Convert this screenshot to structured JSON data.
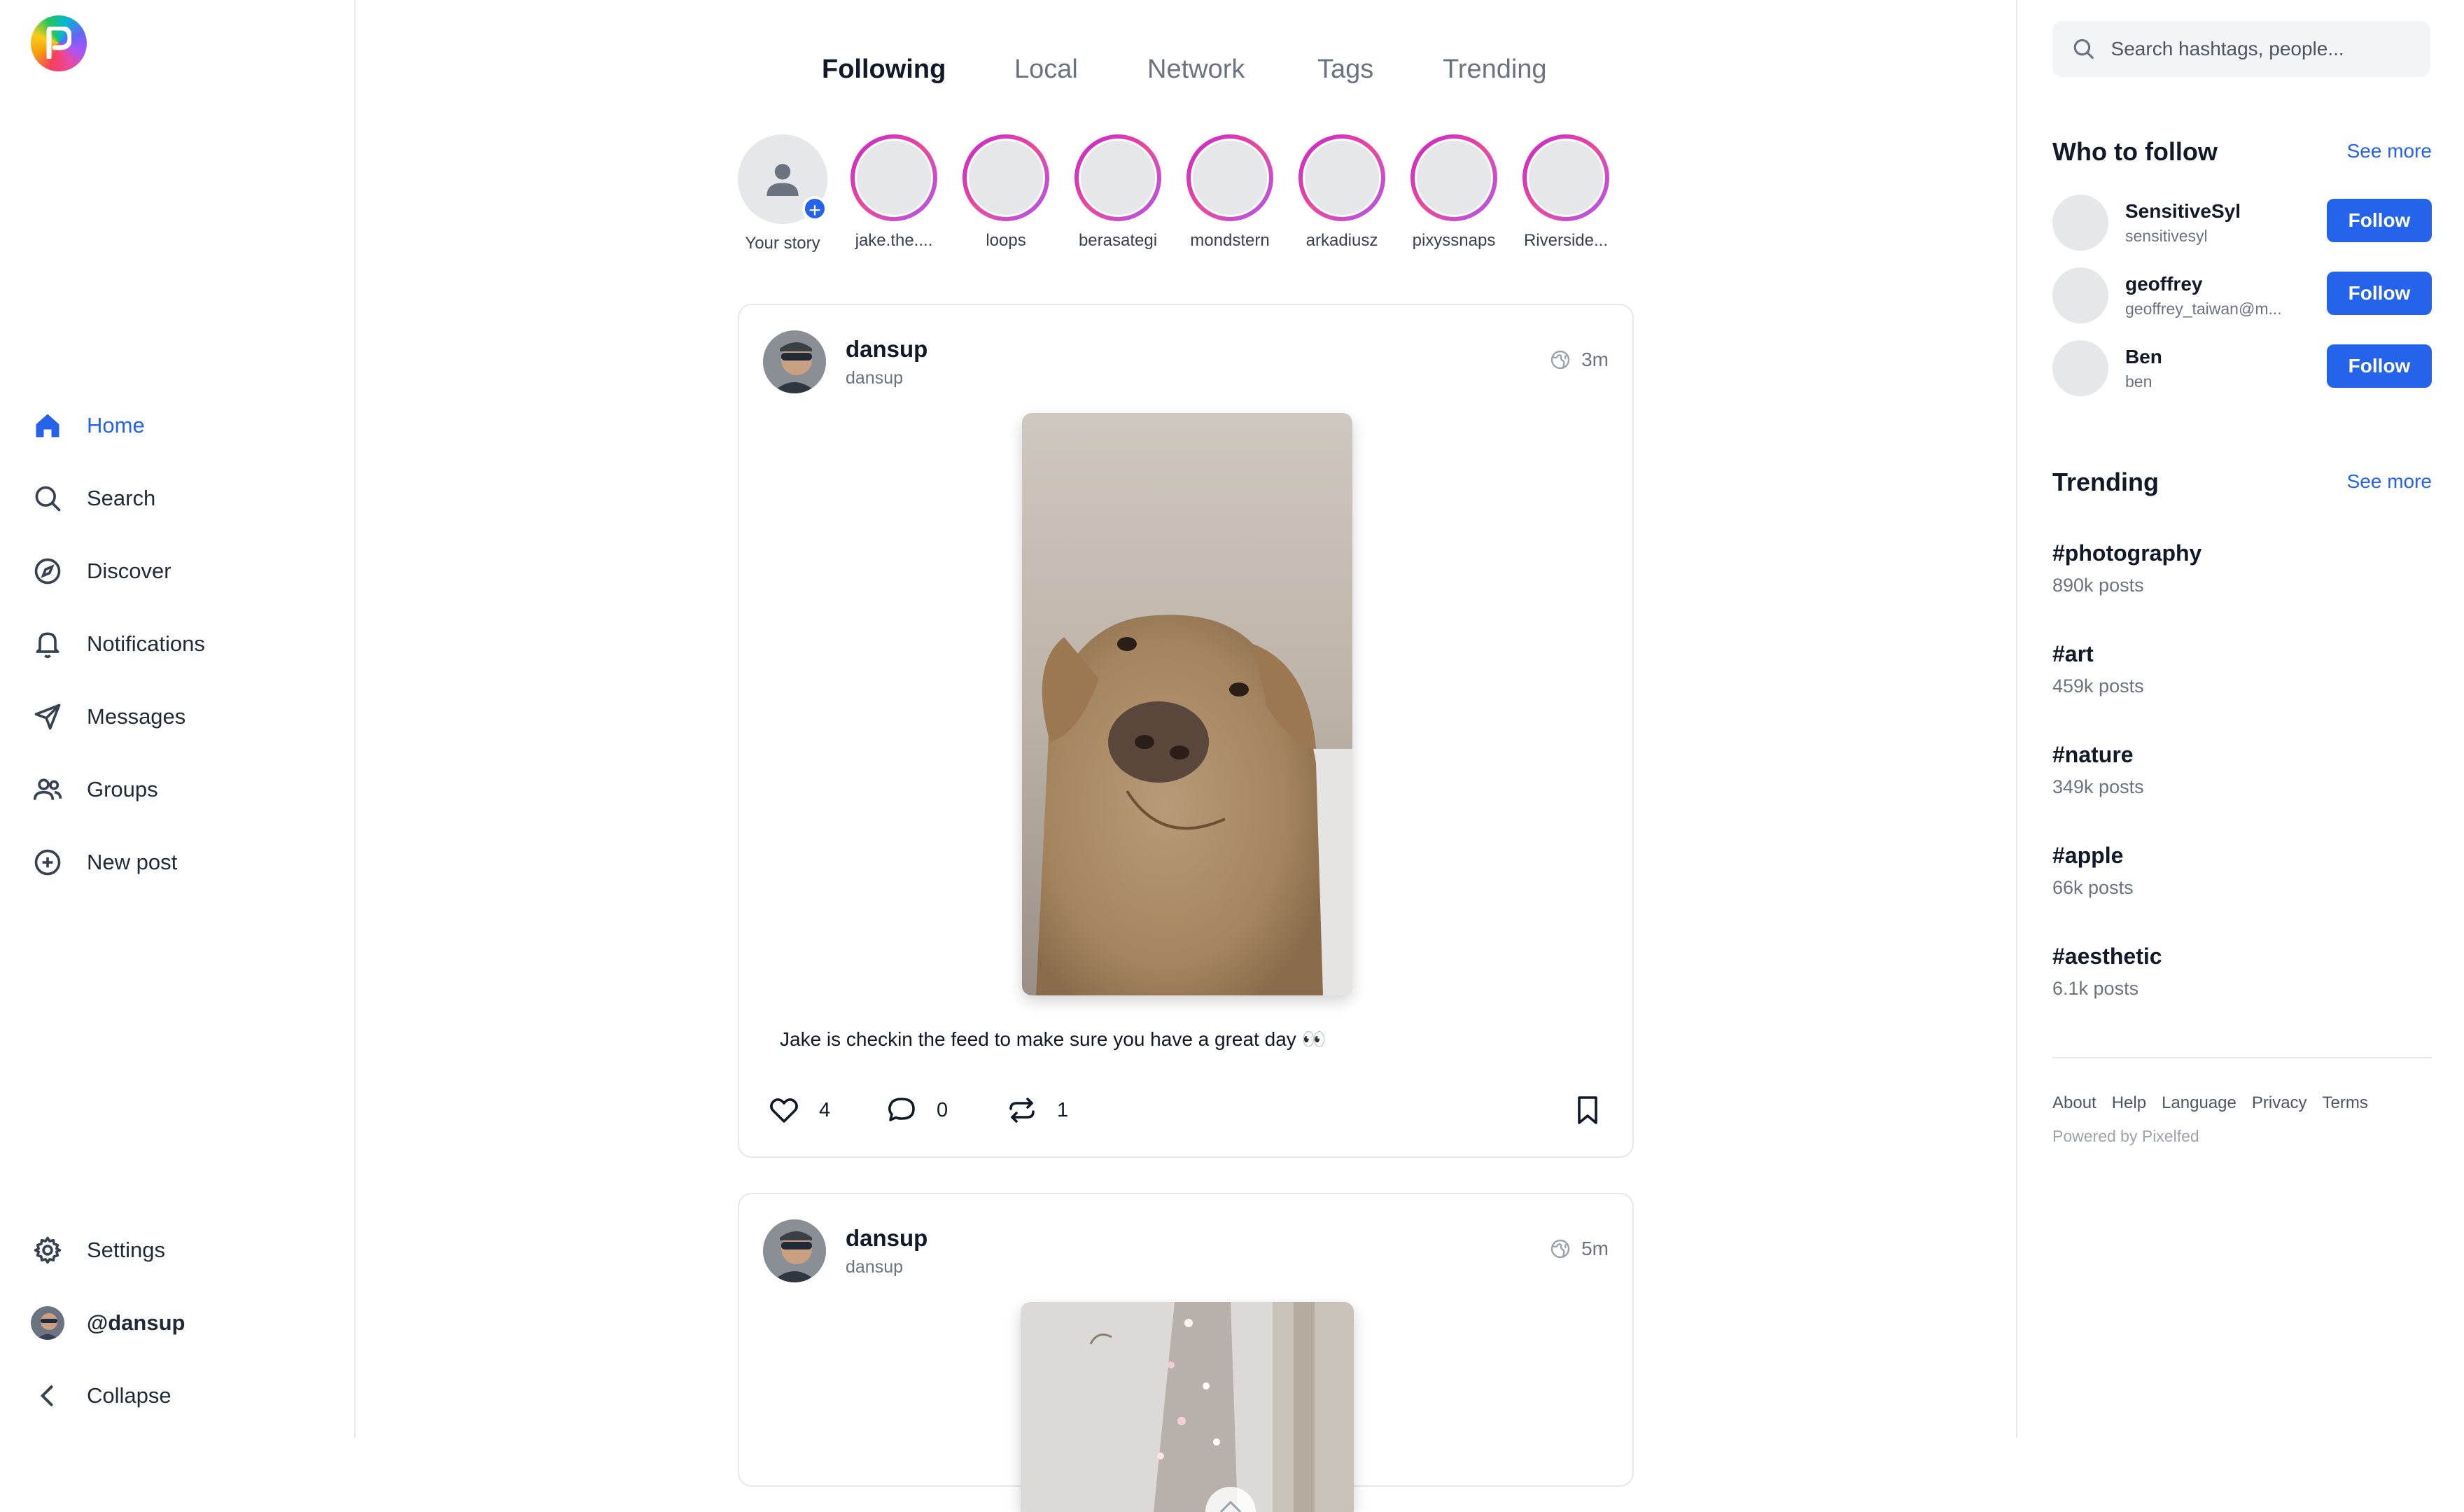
{
  "sidebar": {
    "nav": [
      {
        "label": "Home",
        "icon": "home-icon"
      },
      {
        "label": "Search",
        "icon": "search-icon"
      },
      {
        "label": "Discover",
        "icon": "compass-icon"
      },
      {
        "label": "Notifications",
        "icon": "bell-icon"
      },
      {
        "label": "Messages",
        "icon": "paper-plane-icon"
      },
      {
        "label": "Groups",
        "icon": "users-icon"
      },
      {
        "label": "New post",
        "icon": "plus-circle-icon"
      }
    ],
    "bottom": {
      "settings": "Settings",
      "profile": "@dansup",
      "collapse": "Collapse"
    }
  },
  "tabs": [
    "Following",
    "Local",
    "Network",
    "Tags",
    "Trending"
  ],
  "active_tab": "Following",
  "stories": {
    "your_story": "Your story",
    "items": [
      "jake.the....",
      "loops",
      "berasategi",
      "mondstern",
      "arkadiusz",
      "pixyssnaps",
      "Riverside..."
    ]
  },
  "posts": [
    {
      "username": "dansup",
      "handle": "dansup",
      "time": "3m",
      "caption": "Jake is checkin the feed to make sure you have a great day 👀",
      "likes": "4",
      "comments": "0",
      "shares": "1"
    },
    {
      "username": "dansup",
      "handle": "dansup",
      "time": "5m"
    }
  ],
  "right": {
    "search_placeholder": "Search hashtags, people...",
    "who_to_follow": {
      "title": "Who to follow",
      "see_more": "See more",
      "button": "Follow",
      "people": [
        {
          "name": "SensitiveSyl",
          "handle": "sensitivesyl"
        },
        {
          "name": "geoffrey",
          "handle": "geoffrey_taiwan@m..."
        },
        {
          "name": "Ben",
          "handle": "ben"
        }
      ]
    },
    "trending": {
      "title": "Trending",
      "see_more": "See more",
      "tags": [
        {
          "tag": "#photography",
          "count": "890k posts"
        },
        {
          "tag": "#art",
          "count": "459k posts"
        },
        {
          "tag": "#nature",
          "count": "349k posts"
        },
        {
          "tag": "#apple",
          "count": "66k posts"
        },
        {
          "tag": "#aesthetic",
          "count": "6.1k posts"
        }
      ]
    },
    "footer": {
      "links": [
        "About",
        "Help",
        "Language",
        "Privacy",
        "Terms"
      ],
      "powered": "Powered by Pixelfed"
    }
  },
  "colors": {
    "accent": "#2563eb",
    "story_ring": "#c026d3",
    "border": "#e5e7eb"
  }
}
